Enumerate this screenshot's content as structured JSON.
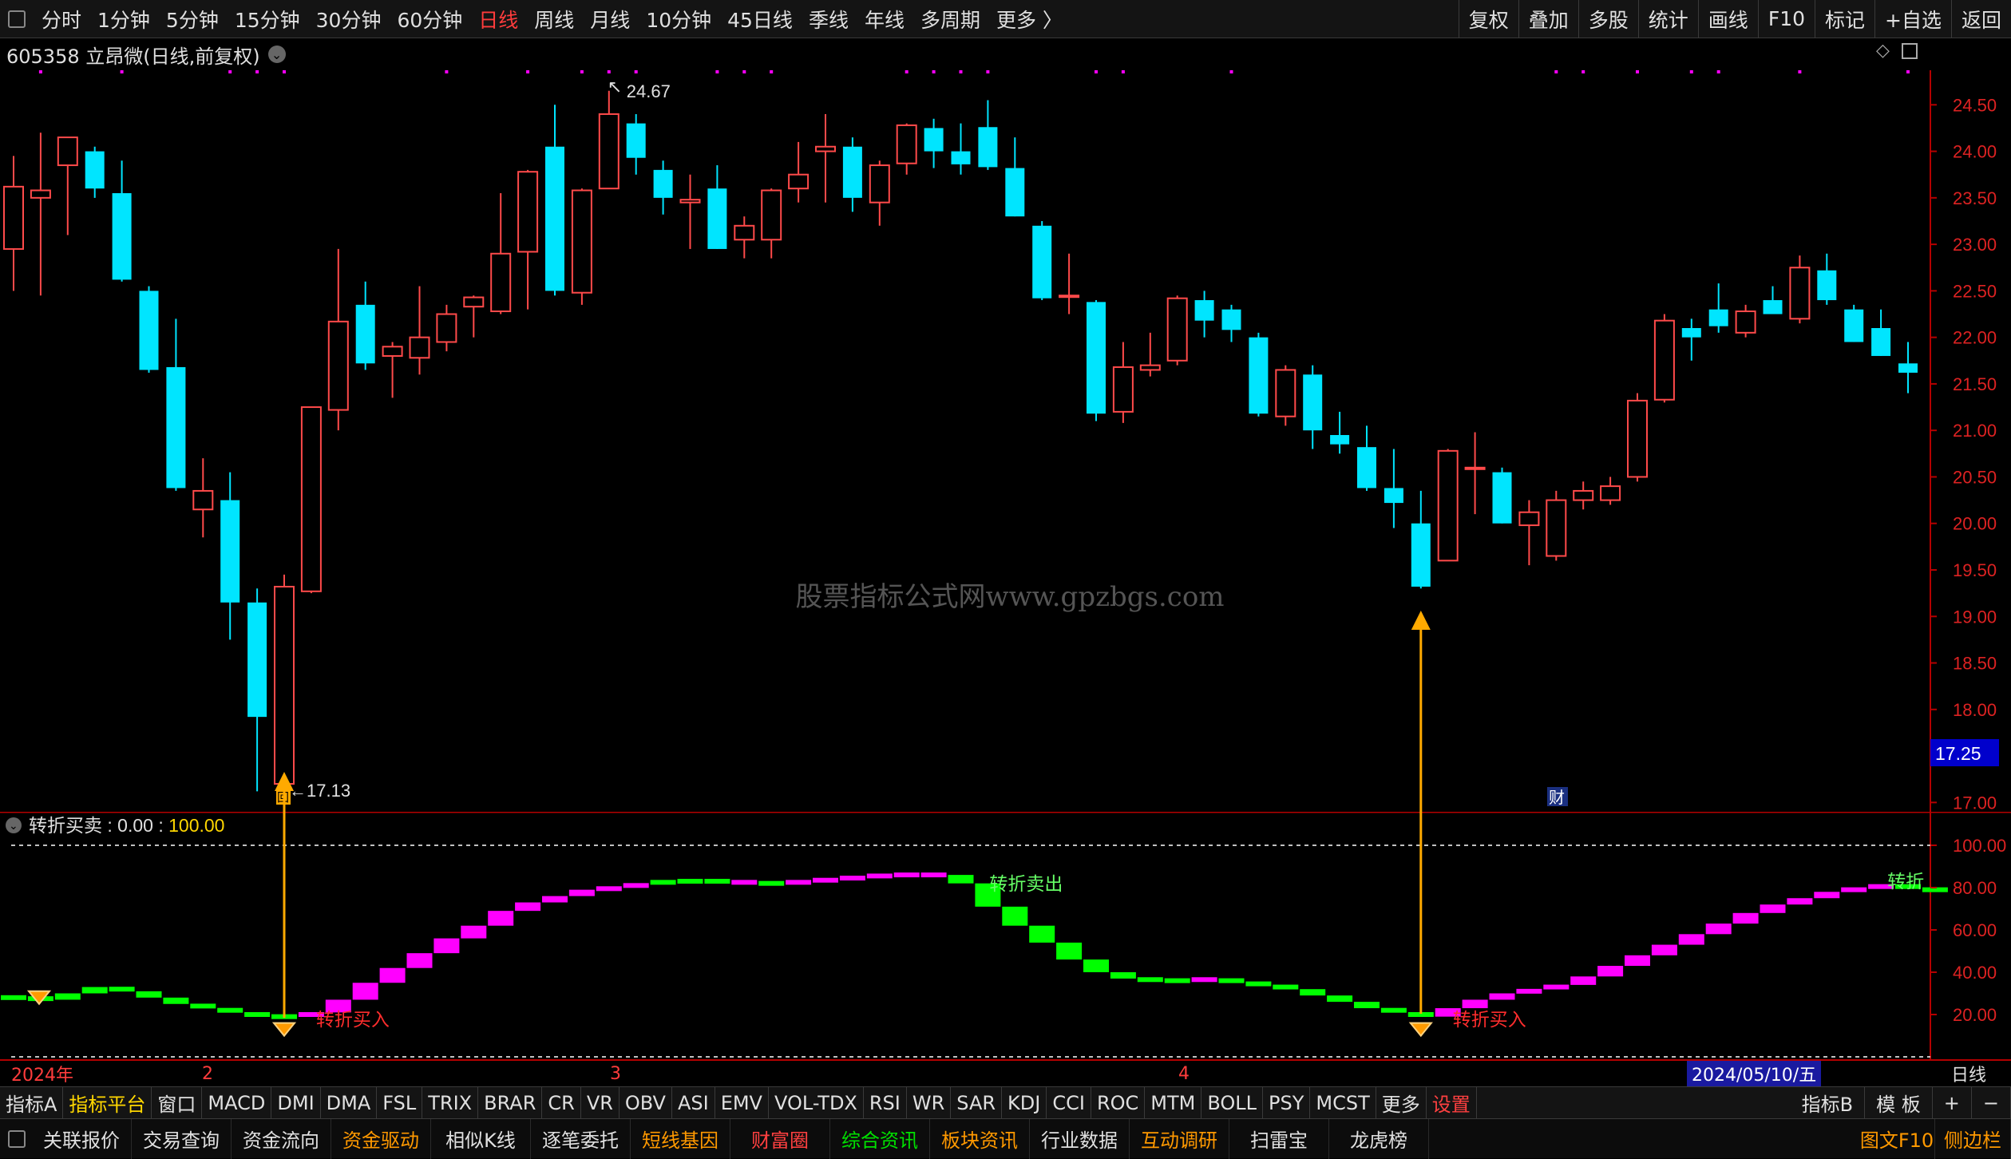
{
  "toolbar": {
    "timeframes": [
      "分时",
      "1分钟",
      "5分钟",
      "15分钟",
      "30分钟",
      "60分钟",
      "日线",
      "周线",
      "月线",
      "10分钟",
      "45日线",
      "季线",
      "年线",
      "多周期",
      "更多 〉"
    ],
    "active_index": 6,
    "right_buttons": [
      "复权",
      "叠加",
      "多股",
      "统计",
      "画线",
      "F10",
      "标记",
      "+自选",
      "返回"
    ]
  },
  "stock": {
    "title": "605358 立昂微(日线,前复权)"
  },
  "price_labels": [
    "24.50",
    "24.00",
    "23.50",
    "23.00",
    "22.50",
    "22.00",
    "21.50",
    "21.00",
    "20.50",
    "20.00",
    "19.50",
    "19.00",
    "18.50",
    "18.00",
    "17.50",
    "17.00"
  ],
  "current_price": "17.25",
  "watermark": "股票指标公式网www.gpzbgs.com",
  "annotations": {
    "high": "24.67",
    "low": "17.13",
    "cai": "财",
    "tip": "回"
  },
  "indicator": {
    "name": "转折买卖",
    "val1": "0.00",
    "val2": "100.00",
    "labels": [
      "100.00",
      "80.00",
      "60.00",
      "40.00",
      "20.00"
    ],
    "buy_label": "转折买入",
    "sell_label": "转折卖出",
    "sell_label_cut": "转折"
  },
  "datebar": {
    "year": "2024年",
    "months": [
      "2",
      "3",
      "4"
    ],
    "cursor_date": "2024/05/10/五",
    "period": "日线"
  },
  "tabs": [
    "指标A",
    "指标平台",
    "窗口",
    "MACD",
    "DMI",
    "DMA",
    "FSL",
    "TRIX",
    "BRAR",
    "CR",
    "VR",
    "OBV",
    "ASI",
    "EMV",
    "VOL-TDX",
    "RSI",
    "WR",
    "SAR",
    "KDJ",
    "CCI",
    "ROC",
    "MTM",
    "BOLL",
    "PSY",
    "MCST",
    "更多",
    "设置"
  ],
  "tabs_right": [
    "指标B",
    "模 板",
    "+",
    "−"
  ],
  "bottom_buttons": [
    {
      "label": "关联报价",
      "color": "#e0e0e0"
    },
    {
      "label": "交易查询",
      "color": "#e0e0e0"
    },
    {
      "label": "资金流向",
      "color": "#e0e0e0"
    },
    {
      "label": "资金驱动",
      "color": "#ff9900"
    },
    {
      "label": "相似K线",
      "color": "#e0e0e0"
    },
    {
      "label": "逐笔委托",
      "color": "#e0e0e0"
    },
    {
      "label": "短线基因",
      "color": "#ff9900"
    },
    {
      "label": "财富圈",
      "color": "#ff4040"
    },
    {
      "label": "综合资讯",
      "color": "#00e000"
    },
    {
      "label": "板块资讯",
      "color": "#ff9900"
    },
    {
      "label": "行业数据",
      "color": "#e0e0e0"
    },
    {
      "label": "互动调研",
      "color": "#ff9900"
    },
    {
      "label": "扫雷宝",
      "color": "#e0e0e0"
    },
    {
      "label": "龙虎榜",
      "color": "#e0e0e0"
    }
  ],
  "bottom_right": [
    "图文F10",
    "侧边栏"
  ],
  "colors": {
    "up": "#ff4a4a",
    "down": "#00e5ff",
    "buy_sig": "#ff00ff",
    "sell_sig": "#00ff00",
    "arrow": "#ffaa00"
  },
  "chart_data": {
    "type": "candlestick",
    "ylim": [
      16.9,
      24.82
    ],
    "candles": [
      {
        "o": 22.95,
        "h": 23.95,
        "l": 22.5,
        "c": 23.62
      },
      {
        "o": 23.5,
        "h": 24.2,
        "l": 22.45,
        "c": 23.58
      },
      {
        "o": 23.85,
        "h": 24.15,
        "l": 23.1,
        "c": 24.15
      },
      {
        "o": 24.0,
        "h": 24.05,
        "l": 23.5,
        "c": 23.6
      },
      {
        "o": 23.55,
        "h": 23.9,
        "l": 22.6,
        "c": 22.62
      },
      {
        "o": 22.5,
        "h": 22.55,
        "l": 21.62,
        "c": 21.65
      },
      {
        "o": 21.68,
        "h": 22.2,
        "l": 20.35,
        "c": 20.38
      },
      {
        "o": 20.15,
        "h": 20.7,
        "l": 19.85,
        "c": 20.35
      },
      {
        "o": 20.25,
        "h": 20.55,
        "l": 18.75,
        "c": 19.15
      },
      {
        "o": 19.15,
        "h": 19.3,
        "l": 17.12,
        "c": 17.92
      },
      {
        "o": 17.2,
        "h": 19.45,
        "l": 17.13,
        "c": 19.32
      },
      {
        "o": 19.27,
        "h": 21.25,
        "l": 19.25,
        "c": 21.25
      },
      {
        "o": 21.22,
        "h": 22.95,
        "l": 21.0,
        "c": 22.17
      },
      {
        "o": 22.35,
        "h": 22.6,
        "l": 21.65,
        "c": 21.72
      },
      {
        "o": 21.8,
        "h": 21.95,
        "l": 21.35,
        "c": 21.9
      },
      {
        "o": 21.78,
        "h": 22.55,
        "l": 21.6,
        "c": 22.0
      },
      {
        "o": 21.95,
        "h": 22.35,
        "l": 21.85,
        "c": 22.25
      },
      {
        "o": 22.33,
        "h": 22.45,
        "l": 22.0,
        "c": 22.43
      },
      {
        "o": 22.28,
        "h": 23.55,
        "l": 22.25,
        "c": 22.9
      },
      {
        "o": 22.92,
        "h": 23.8,
        "l": 22.3,
        "c": 23.78
      },
      {
        "o": 24.05,
        "h": 24.5,
        "l": 22.45,
        "c": 22.5
      },
      {
        "o": 22.48,
        "h": 23.6,
        "l": 22.35,
        "c": 23.58
      },
      {
        "o": 23.6,
        "h": 24.65,
        "l": 23.6,
        "c": 24.4
      },
      {
        "o": 24.3,
        "h": 24.4,
        "l": 23.75,
        "c": 23.93
      },
      {
        "o": 23.8,
        "h": 23.9,
        "l": 23.32,
        "c": 23.5
      },
      {
        "o": 23.45,
        "h": 23.75,
        "l": 22.95,
        "c": 23.48
      },
      {
        "o": 23.6,
        "h": 23.85,
        "l": 22.95,
        "c": 22.95
      },
      {
        "o": 23.05,
        "h": 23.3,
        "l": 22.85,
        "c": 23.2
      },
      {
        "o": 23.05,
        "h": 23.6,
        "l": 22.85,
        "c": 23.58
      },
      {
        "o": 23.6,
        "h": 24.1,
        "l": 23.45,
        "c": 23.75
      },
      {
        "o": 24.0,
        "h": 24.4,
        "l": 23.45,
        "c": 24.05
      },
      {
        "o": 24.05,
        "h": 24.15,
        "l": 23.35,
        "c": 23.5
      },
      {
        "o": 23.45,
        "h": 23.9,
        "l": 23.2,
        "c": 23.85
      },
      {
        "o": 23.87,
        "h": 24.3,
        "l": 23.75,
        "c": 24.28
      },
      {
        "o": 24.25,
        "h": 24.35,
        "l": 23.82,
        "c": 24.0
      },
      {
        "o": 24.0,
        "h": 24.3,
        "l": 23.75,
        "c": 23.86
      },
      {
        "o": 24.26,
        "h": 24.55,
        "l": 23.8,
        "c": 23.83
      },
      {
        "o": 23.82,
        "h": 24.15,
        "l": 23.3,
        "c": 23.3
      },
      {
        "o": 23.2,
        "h": 23.25,
        "l": 22.4,
        "c": 22.42
      },
      {
        "o": 22.45,
        "h": 22.9,
        "l": 22.25,
        "c": 22.45
      },
      {
        "o": 22.38,
        "h": 22.4,
        "l": 21.1,
        "c": 21.18
      },
      {
        "o": 21.2,
        "h": 21.95,
        "l": 21.08,
        "c": 21.68
      },
      {
        "o": 21.65,
        "h": 22.05,
        "l": 21.58,
        "c": 21.7
      },
      {
        "o": 21.75,
        "h": 22.45,
        "l": 21.7,
        "c": 22.42
      },
      {
        "o": 22.4,
        "h": 22.5,
        "l": 22.0,
        "c": 22.18
      },
      {
        "o": 22.3,
        "h": 22.35,
        "l": 21.95,
        "c": 22.08
      },
      {
        "o": 22.0,
        "h": 22.05,
        "l": 21.15,
        "c": 21.18
      },
      {
        "o": 21.15,
        "h": 21.7,
        "l": 21.05,
        "c": 21.65
      },
      {
        "o": 21.6,
        "h": 21.7,
        "l": 20.8,
        "c": 21.0
      },
      {
        "o": 20.95,
        "h": 21.2,
        "l": 20.75,
        "c": 20.85
      },
      {
        "o": 20.82,
        "h": 21.05,
        "l": 20.35,
        "c": 20.38
      },
      {
        "o": 20.38,
        "h": 20.8,
        "l": 19.95,
        "c": 20.22
      },
      {
        "o": 20.0,
        "h": 20.35,
        "l": 19.3,
        "c": 19.32
      },
      {
        "o": 19.6,
        "h": 20.8,
        "l": 19.6,
        "c": 20.78
      },
      {
        "o": 20.6,
        "h": 20.98,
        "l": 20.1,
        "c": 20.6
      },
      {
        "o": 20.55,
        "h": 20.6,
        "l": 20.0,
        "c": 20.0
      },
      {
        "o": 19.98,
        "h": 20.25,
        "l": 19.55,
        "c": 20.12
      },
      {
        "o": 19.65,
        "h": 20.35,
        "l": 19.6,
        "c": 20.25
      },
      {
        "o": 20.25,
        "h": 20.45,
        "l": 20.15,
        "c": 20.35
      },
      {
        "o": 20.25,
        "h": 20.5,
        "l": 20.2,
        "c": 20.4
      },
      {
        "o": 20.5,
        "h": 21.4,
        "l": 20.45,
        "c": 21.32
      },
      {
        "o": 21.33,
        "h": 22.25,
        "l": 21.3,
        "c": 22.18
      },
      {
        "o": 22.1,
        "h": 22.2,
        "l": 21.75,
        "c": 22.0
      },
      {
        "o": 22.3,
        "h": 22.58,
        "l": 22.05,
        "c": 22.12
      },
      {
        "o": 22.05,
        "h": 22.35,
        "l": 22.0,
        "c": 22.28
      },
      {
        "o": 22.4,
        "h": 22.55,
        "l": 22.25,
        "c": 22.25
      },
      {
        "o": 22.2,
        "h": 22.88,
        "l": 22.15,
        "c": 22.75
      },
      {
        "o": 22.72,
        "h": 22.9,
        "l": 22.35,
        "c": 22.4
      },
      {
        "o": 22.3,
        "h": 22.35,
        "l": 21.95,
        "c": 21.95
      },
      {
        "o": 22.1,
        "h": 22.3,
        "l": 21.8,
        "c": 21.8
      },
      {
        "o": 21.72,
        "h": 21.95,
        "l": 21.4,
        "c": 21.62
      }
    ],
    "indicator_values": [
      28,
      27,
      30,
      33,
      31,
      28,
      25,
      23,
      21,
      19,
      19,
      21,
      27,
      35,
      42,
      49,
      56,
      62,
      69,
      73,
      76,
      79,
      80,
      82,
      83,
      83,
      83,
      82,
      82,
      83,
      84,
      85,
      86,
      86,
      86,
      82,
      71,
      62,
      54,
      46,
      40,
      37,
      36,
      36,
      37,
      35,
      34,
      32,
      29,
      26,
      23,
      21,
      19,
      23,
      27,
      30,
      32,
      34,
      38,
      43,
      48,
      53,
      58,
      63,
      68,
      72,
      75,
      78,
      80,
      81,
      80,
      78
    ],
    "signals": [
      0,
      0,
      0,
      0,
      0,
      0,
      0,
      0,
      0,
      0,
      0,
      1,
      1,
      1,
      1,
      1,
      1,
      1,
      1,
      1,
      1,
      1,
      1,
      1,
      0,
      0,
      0,
      1,
      0,
      1,
      1,
      1,
      1,
      1,
      1,
      0,
      0,
      0,
      0,
      0,
      0,
      0,
      0,
      0,
      1,
      0,
      0,
      0,
      0,
      0,
      0,
      0,
      0,
      1,
      1,
      1,
      1,
      1,
      1,
      1,
      1,
      1,
      1,
      1,
      1,
      1,
      1,
      1,
      1,
      1,
      0,
      0
    ],
    "dot_indices": [
      1,
      4,
      8,
      9,
      10,
      16,
      19,
      21,
      22,
      23,
      26,
      27,
      28,
      33,
      34,
      35,
      36,
      40,
      41,
      45,
      57,
      58,
      60,
      62,
      63,
      66,
      70
    ]
  }
}
